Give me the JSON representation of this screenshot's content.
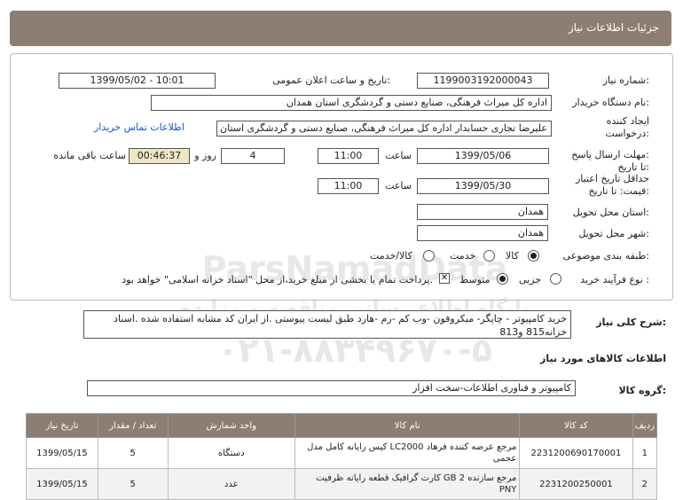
{
  "header": {
    "title": "جزئیات اطلاعات نیاز"
  },
  "form": {
    "need_number_label": "شماره نیاز:",
    "need_number": "1199003192000043",
    "announce_label": "تاریخ و ساعت اعلان عمومی:",
    "announce_value": "1399/05/02 - 10:01",
    "buyer_org_label": "نام دستگاه خریدار:",
    "buyer_org": "اداره کل میراث فرهنگی، صنایع دستی و گردشگری استان همدان",
    "creator_label_1": "ایجاد کننده",
    "creator_label_2": "درخواست:",
    "creator": "علیرضا تجاری حسابدار اداره کل میراث فرهنگی، صنایع دستی و گردشگری استان",
    "contact_link": "اطلاعات تماس خریدار",
    "send_deadline_label_1": "مهلت ارسال پاسخ:",
    "send_deadline_label_2": "تا تاریخ:",
    "send_date": "1399/05/06",
    "time_label": "ساعت",
    "send_time": "11:00",
    "days_value": "4",
    "days_label": "روز و",
    "remaining_time": "00:46:37",
    "remaining_label": "ساعت باقی مانده",
    "validity_label_1": "حداقل تاریخ اعتبار",
    "validity_label_2": "قیمت: تا تاریخ:",
    "validity_date": "1399/05/30",
    "validity_time": "11:00",
    "province_label": "استان محل تحویل:",
    "province": "همدان",
    "city_label": "شهر محل تحویل:",
    "city": "همدان",
    "category_label": "طبقه بندی موضوعی:",
    "category_options": [
      "کالا",
      "خدمت",
      "کالا/خدمت"
    ],
    "purchase_label": "نوع فرآیند خرید :",
    "purchase_options": [
      "جزیی",
      "متوسط"
    ],
    "payment_note": "پرداخت تمام یا بخشی از مبلغ خرید،از محل \"اسناد خزانه اسلامی\" خواهد بود."
  },
  "description": {
    "label": "شرح کلی نیاز:",
    "text": "خرید کامپیوتر - چاپگر- میکروفون -وب کم -رم -هارد طبق لیست پیوستی .از ایران کد مشابه استفاده شده .اسناد خزانه815 و813"
  },
  "goods_info_title": "اطلاعات کالاهای مورد نیاز",
  "goods_group_label": "گروه کالا:",
  "goods_group": "کامپیوتر و فناوری اطلاعات-سخت افزار",
  "watermark": {
    "line1": "ParsNamadData",
    "line2": "پایگاه اطلاع رسانی مناقصه و مزایده",
    "line3": "۰۲۱-۸۸۳۴۹۶۷۰-۵"
  },
  "table": {
    "headers": [
      "ردیف",
      "کد کالا",
      "نام کالا",
      "واحد شمارش",
      "تعداد / مقدار",
      "تاریخ نیاز"
    ],
    "rows": [
      {
        "idx": "1",
        "code": "2231200690170001",
        "name": "کیس رایانه کامل مدل LC2000 مرجع عرضه کننده فرهاد عجمی",
        "unit": "دستگاه",
        "qty": "5",
        "date": "1399/05/15"
      },
      {
        "idx": "2",
        "code": "2231200250001",
        "name": "کارت گرافیک قطعه رایانه ظرفیت GB 2 مرجع سازنده PNY",
        "unit": "عدد",
        "qty": "5",
        "date": "1399/05/15"
      }
    ]
  }
}
